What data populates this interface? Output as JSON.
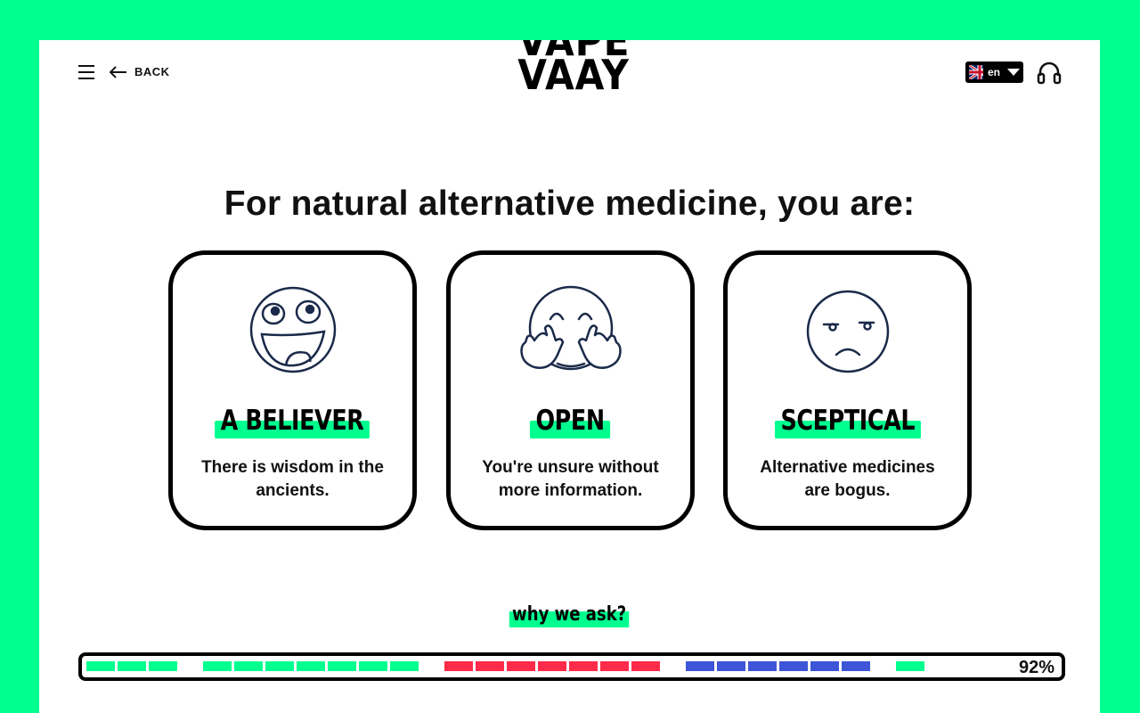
{
  "header": {
    "back_label": "BACK",
    "logo_line1": "VAPE",
    "logo_line2": "VAAY",
    "language": "en"
  },
  "question": "For natural alternative medicine,  you are:",
  "options": [
    {
      "label": "A BELIEVER",
      "description": "There is wisdom in the ancients.",
      "icon": "grinning-face-icon"
    },
    {
      "label": "OPEN",
      "description": "You're unsure without more information.",
      "icon": "hugging-face-icon"
    },
    {
      "label": "SCEPTICAL",
      "description": "Alternative medicines are bogus.",
      "icon": "skeptical-face-icon"
    }
  ],
  "why_label": "why we ask?",
  "progress": {
    "percent_label": "92%",
    "percent": 92,
    "colors": {
      "green": "#00ff8f",
      "red": "#ff2b4a",
      "blue": "#3d55d6"
    },
    "segment_groups": [
      {
        "color": "green",
        "count": 3
      },
      {
        "color": "green",
        "count": 7
      },
      {
        "color": "red",
        "count": 7
      },
      {
        "color": "blue",
        "count": 6
      },
      {
        "color": "green",
        "count": 1
      }
    ]
  },
  "accent_color": "#00ff8f"
}
